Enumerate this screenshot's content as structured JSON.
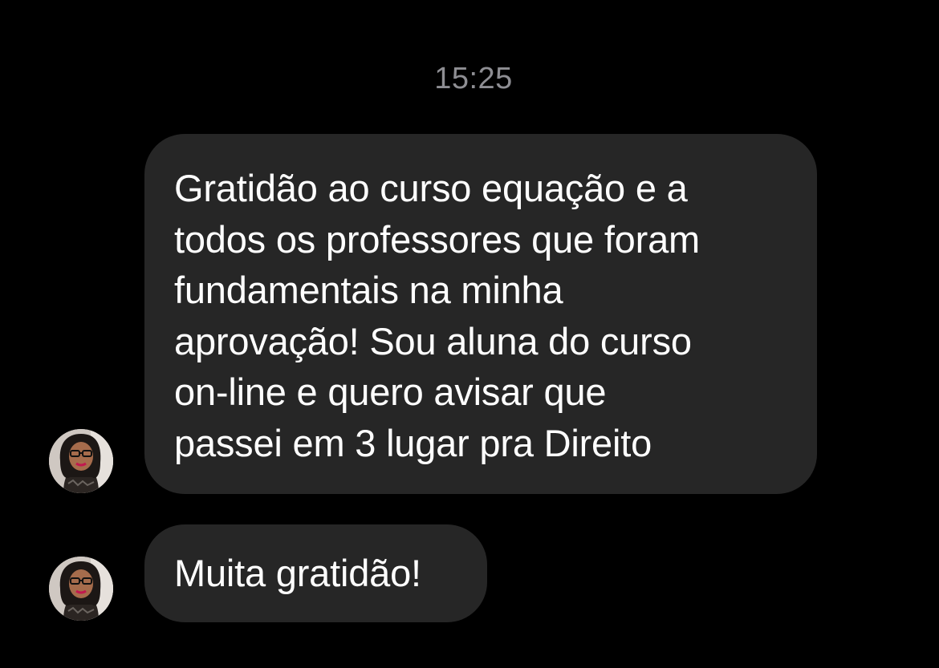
{
  "conversation": {
    "timestamp": "15:25",
    "messages": [
      {
        "lines": [
          "Gratidão ao curso equação e a",
          "todos os professores que foram",
          "fundamentais na minha",
          "aprovação! Sou aluna do curso",
          "on-line e quero avisar que",
          "passei em 3 lugar pra Direito"
        ]
      },
      {
        "text": "Muita gratidão!"
      }
    ]
  },
  "colors": {
    "background": "#000000",
    "bubble": "#262626",
    "text": "#ffffff",
    "timestamp": "#8e8e93"
  },
  "icons": {
    "sender_avatar": "profile-photo"
  }
}
